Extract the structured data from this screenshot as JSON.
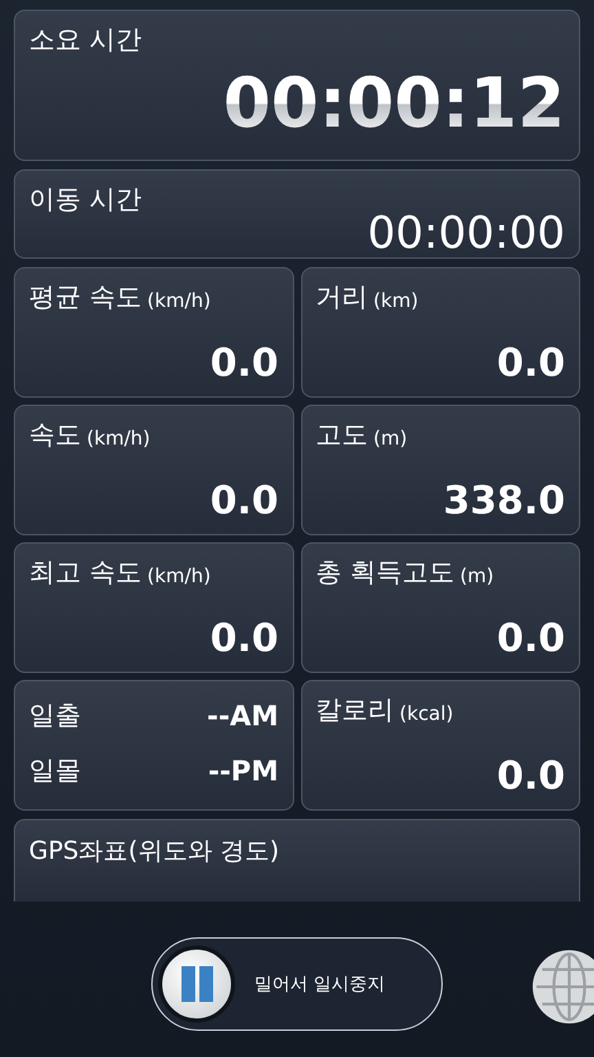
{
  "elapsed": {
    "label": "소요 시간",
    "value": "00:00:12"
  },
  "moving": {
    "label": "이동 시간",
    "value": "00:00:00"
  },
  "cells": [
    {
      "kind": "metric",
      "label": "평균 속도",
      "unit": "(km/h)",
      "value": "0.0"
    },
    {
      "kind": "metric",
      "label": "거리",
      "unit": "(km)",
      "value": "0.0"
    },
    {
      "kind": "metric",
      "label": "속도",
      "unit": "(km/h)",
      "value": "0.0"
    },
    {
      "kind": "metric",
      "label": "고도",
      "unit": "(m)",
      "value": "338.0"
    },
    {
      "kind": "metric",
      "label": "최고 속도",
      "unit": "(km/h)",
      "value": "0.0"
    },
    {
      "kind": "metric",
      "label": "총 획득고도",
      "unit": "(m)",
      "value": "0.0"
    },
    {
      "kind": "sun",
      "rows": [
        {
          "label": "일출",
          "value": "--AM"
        },
        {
          "label": "일몰",
          "value": "--PM"
        }
      ]
    },
    {
      "kind": "metric",
      "label": "칼로리",
      "unit": "(kcal)",
      "value": "0.0"
    }
  ],
  "gps": {
    "label": "GPS좌표(위도와 경도)"
  },
  "slider": {
    "label": "밀어서 일시중지"
  }
}
